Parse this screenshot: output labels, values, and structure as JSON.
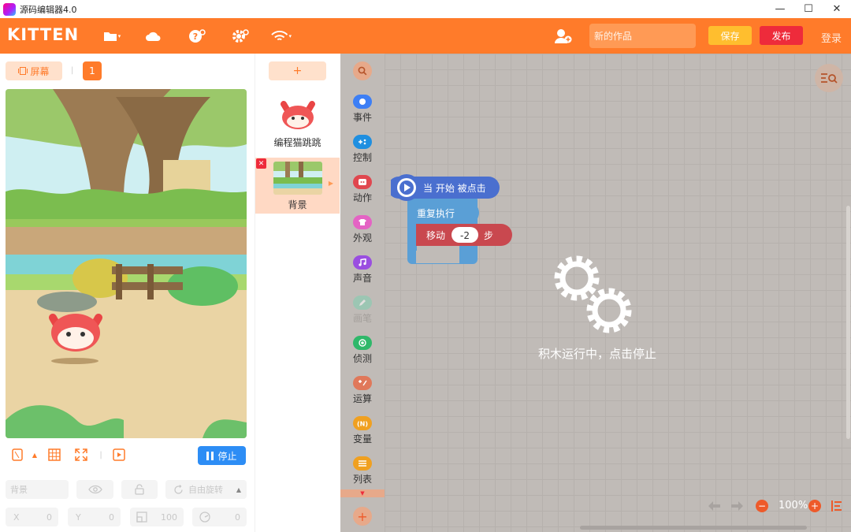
{
  "window": {
    "title": "源码编辑器4.0",
    "minimize": "—",
    "maximize": "☐",
    "close": "✕"
  },
  "topbar": {
    "logo": "KITTEN",
    "work_name_placeholder": "新的作品",
    "save_label": "保存",
    "publish_label": "发布",
    "login_label": "登录",
    "brand_color": "#ff7b2a",
    "icons": [
      "folder-icon",
      "cloud-icon",
      "help-icon",
      "settings-icon",
      "wifi-icon",
      "add-user-icon"
    ]
  },
  "stage_panel": {
    "screen_label": "屏幕",
    "screen_number": "1",
    "separator": "|",
    "stop_label": "停止"
  },
  "properties": {
    "name_placeholder": "背景",
    "rotation_label": "自由旋转",
    "x_label": "X",
    "x_value": "0",
    "y_label": "Y",
    "y_value": "0",
    "size_value": "100",
    "direction_value": "0"
  },
  "sprites": {
    "add_label": "+",
    "items": [
      {
        "name": "编程猫跳跳"
      },
      {
        "name": "背景"
      }
    ]
  },
  "categories": [
    {
      "label": "事件",
      "color": "#3d7ff5",
      "icon": "event-icon"
    },
    {
      "label": "控制",
      "color": "#1f8fe0",
      "icon": "control-icon"
    },
    {
      "label": "动作",
      "color": "#e0474f",
      "icon": "motion-icon"
    },
    {
      "label": "外观",
      "color": "#e463c4",
      "icon": "looks-icon"
    },
    {
      "label": "声音",
      "color": "#9a4ee0",
      "icon": "sound-icon"
    },
    {
      "label": "画笔",
      "color": "#7fd0b0",
      "icon": "pen-icon"
    },
    {
      "label": "侦测",
      "color": "#2fb86a",
      "icon": "sensing-icon"
    },
    {
      "label": "运算",
      "color": "#e0785a",
      "icon": "operators-icon"
    },
    {
      "label": "变量",
      "color": "#f0a020",
      "icon": "variables-icon"
    },
    {
      "label": "列表",
      "color": "#f0a020",
      "icon": "list-icon"
    }
  ],
  "workspace": {
    "blocks": {
      "hat": "当 开始 被点击",
      "repeat": "重复执行",
      "move": "移动",
      "move_value": "-2",
      "move_unit": "步"
    },
    "running_message": "积木运行中，点击停止",
    "zoom": "100%",
    "zoom_out": "−",
    "zoom_in": "+"
  }
}
